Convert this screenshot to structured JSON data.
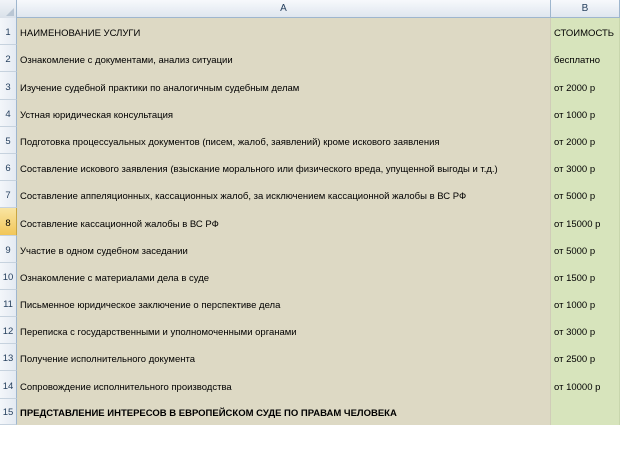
{
  "columns": {
    "a": "A",
    "b": "B"
  },
  "selected_row": 8,
  "rows": [
    {
      "num": "1",
      "a": "НАИМЕНОВАНИЕ УСЛУГИ",
      "b": "СТОИМОСТЬ"
    },
    {
      "num": "2",
      "a": "Ознакомление с документами, анализ ситуации",
      "b": "бесплатно"
    },
    {
      "num": "3",
      "a": "Изучение судебной практики по аналогичным судебным делам",
      "b": "от 2000 р"
    },
    {
      "num": "4",
      "a": "Устная юридическая консультация",
      "b": "от 1000 р"
    },
    {
      "num": "5",
      "a": "Подготовка процессуальных документов (писем, жалоб, заявлений) кроме искового заявления",
      "b": "от 2000 р"
    },
    {
      "num": "6",
      "a": "Составление искового заявления (взыскание морального или физического вреда, упущенной выгоды и т.д.)",
      "b": "от 3000 р"
    },
    {
      "num": "7",
      "a": "Составление аппеляционных, кассационных жалоб, за исключением кассационной жалобы в ВС РФ",
      "b": "от 5000 р"
    },
    {
      "num": "8",
      "a": "Составление кассационной жалобы в ВС РФ",
      "b": "от 15000 р"
    },
    {
      "num": "9",
      "a": "Участие в одном судебном заседании",
      "b": "от 5000 р"
    },
    {
      "num": "10",
      "a": "Ознакомление с материалами дела в суде",
      "b": "от 1500 р"
    },
    {
      "num": "11",
      "a": "Письменное юридическое заключение о перспективе дела",
      "b": "от 1000 р"
    },
    {
      "num": "12",
      "a": "Переписка с государственными и уполномоченными органами",
      "b": "от 3000 р"
    },
    {
      "num": "13",
      "a": "Получение исполнительного документа",
      "b": "от 2500 р"
    },
    {
      "num": "14",
      "a": "Сопровождение исполнительного производства",
      "b": "от 10000 р"
    },
    {
      "num": "15",
      "a": "ПРЕДСТАВЛЕНИЕ ИНТЕРЕСОВ В ЕВРОПЕЙСКОМ СУДЕ ПО ПРАВАМ ЧЕЛОВЕКА",
      "b": ""
    }
  ]
}
